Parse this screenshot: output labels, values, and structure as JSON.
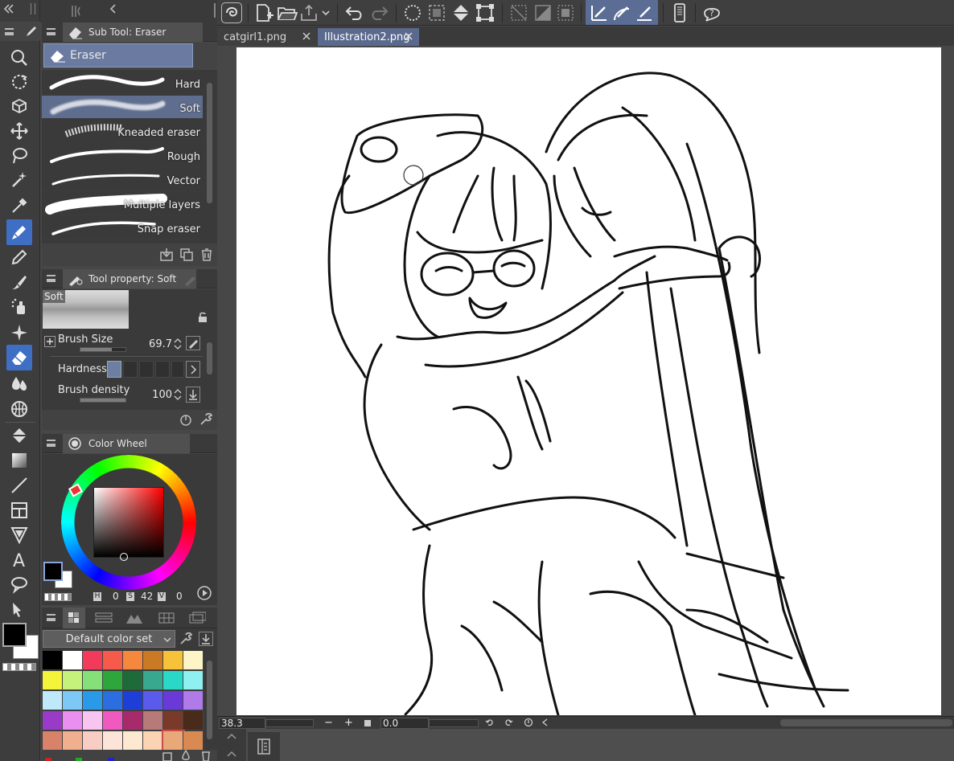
{
  "subtool_panel": {
    "title": "Sub Tool: Eraser",
    "group_label": "Eraser",
    "brushes": [
      {
        "label": "Hard",
        "selected": false
      },
      {
        "label": "Soft",
        "selected": true
      },
      {
        "label": "Kneaded eraser",
        "selected": false
      },
      {
        "label": "Rough",
        "selected": false
      },
      {
        "label": "Vector",
        "selected": false
      },
      {
        "label": "Multiple layers",
        "selected": false
      },
      {
        "label": "Snap eraser",
        "selected": false
      }
    ]
  },
  "tool_property": {
    "title": "Tool property: Soft",
    "preview_label": "Soft",
    "brush_size_label": "Brush Size",
    "brush_size_value": "69.7",
    "hardness_label": "Hardness",
    "brush_density_label": "Brush density",
    "brush_density_value": "100"
  },
  "color_wheel": {
    "title": "Color Wheel",
    "h_label": "H",
    "h_value": "0",
    "s_label": "S",
    "s_value": "42",
    "v_label": "V",
    "v_value": "0",
    "main_color": "#000000",
    "sub_color": "#ffffff"
  },
  "color_set": {
    "selected_set": "Default color set",
    "swatches": [
      "#000000",
      "#ffffff",
      "#f23a5a",
      "#f55a4a",
      "#f5883c",
      "#c97a23",
      "#f6c23a",
      "#fdf5c8",
      "#f4f43a",
      "#c4f27a",
      "#86e07a",
      "#2ea63c",
      "#1f6a3a",
      "#38a88e",
      "#2ad8c8",
      "#8ef0f0",
      "#bfe8fb",
      "#7dc8f5",
      "#2a9ae8",
      "#2a6ee0",
      "#1e3ed8",
      "#5a5aec",
      "#6a3ad8",
      "#b07ae8",
      "#9a3ac8",
      "#ea8ef0",
      "#f8c4f0",
      "#f05ac0",
      "#a82a6a",
      "#b87a78",
      "#7a3a2a",
      "#4a2a1a",
      "#d8826a",
      "#f0b090",
      "#f8cec4",
      "#fde4d8",
      "#fde8d0",
      "#fbd4b4",
      "#e8a878",
      "#d88a52"
    ],
    "selected_swatch_index": 38
  },
  "document_tabs": [
    {
      "label": "catgirl1.png",
      "active": false
    },
    {
      "label": "Illustration2.png",
      "active": true
    }
  ],
  "status_bar": {
    "zoom": "38.3",
    "rotation": "0.0"
  }
}
